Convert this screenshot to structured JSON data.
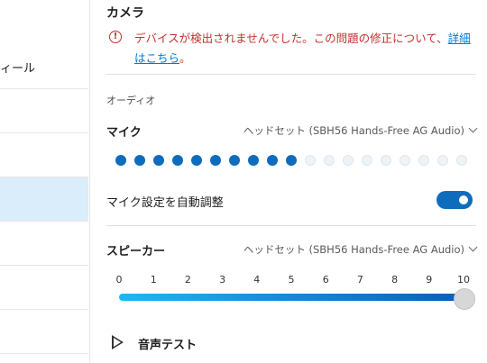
{
  "sidebar": {
    "items": [
      {
        "label": "ィール",
        "active": false
      },
      {
        "label": "",
        "active": false
      },
      {
        "label": "",
        "active": false
      },
      {
        "label": "",
        "active": true
      },
      {
        "label": "",
        "active": false
      },
      {
        "label": "",
        "active": false
      },
      {
        "label": "",
        "active": false
      }
    ]
  },
  "camera": {
    "title": "カメラ",
    "error_icon": "alert-circle-icon",
    "error_text": "デバイスが検出されませんでした。この問題の修正について、",
    "error_link_1": "詳細",
    "error_link_2": "はこちら",
    "error_tail": "。"
  },
  "audio": {
    "section_title": "オーディオ",
    "mic": {
      "label": "マイク",
      "device": "ヘッドセット (SBH56 Hands-Free AG Audio)",
      "level_dots_total": 19,
      "level_dots_active": 10,
      "auto_adjust_label": "マイク設定を自動調整",
      "auto_adjust_on": true
    },
    "speaker": {
      "label": "スピーカー",
      "device": "ヘッドセット (SBH56 Hands-Free AG Audio)",
      "scale": [
        "0",
        "1",
        "2",
        "3",
        "4",
        "5",
        "6",
        "7",
        "8",
        "9",
        "10"
      ],
      "volume": 10,
      "test_label": "音声テスト"
    }
  },
  "colors": {
    "accent": "#0f6cbd",
    "error": "#c4312f",
    "active_sidebar": "#d9edfb"
  }
}
